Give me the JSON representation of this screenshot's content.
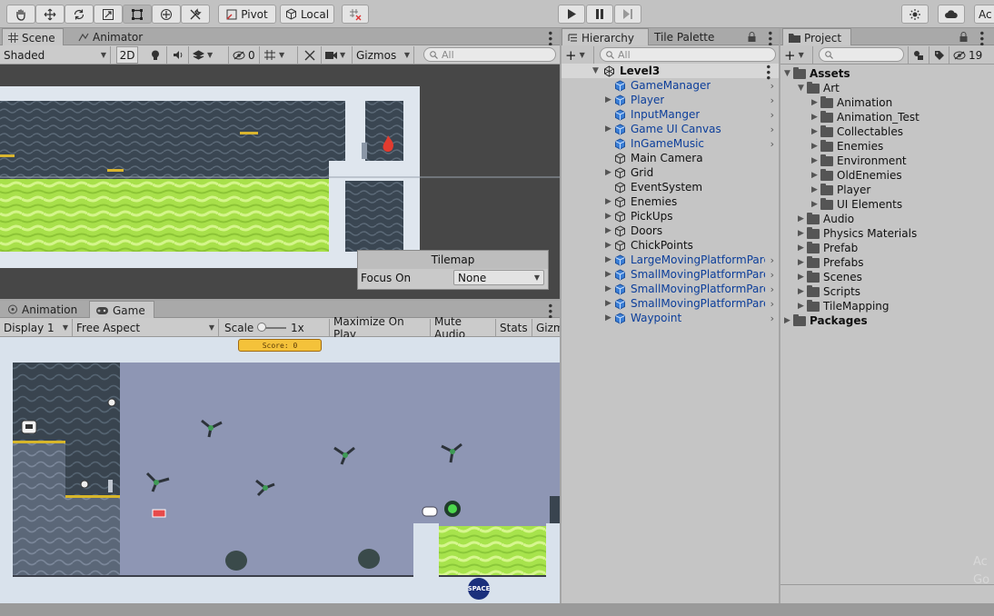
{
  "toolbar": {
    "pivot_label": "Pivot",
    "local_label": "Local",
    "account_label": "Ac"
  },
  "scene": {
    "tabs": [
      "Scene",
      "Animator"
    ],
    "shading_mode": "Shaded",
    "mode_2d": "2D",
    "hidden_count": "0",
    "gizmos_label": "Gizmos",
    "search_placeholder": "All",
    "tilemap_overlay": {
      "title": "Tilemap",
      "focus_label": "Focus On",
      "focus_value": "None"
    }
  },
  "game": {
    "tabs": [
      "Animation",
      "Game"
    ],
    "display": "Display 1",
    "aspect": "Free Aspect",
    "scale_label": "Scale",
    "scale_value": "1x",
    "maximize_label": "Maximize On Play",
    "mute_label": "Mute Audio",
    "stats_label": "Stats",
    "gizmos_label": "Gizm",
    "score_text": "Score: 0",
    "logo_text": "SPACE"
  },
  "hierarchy": {
    "tabs": [
      "Hierarchy",
      "Tile Palette"
    ],
    "search_placeholder": "All",
    "scene_name": "Level3",
    "items": [
      {
        "label": "GameManager",
        "prefab": true,
        "expandable": false
      },
      {
        "label": "Player",
        "prefab": true,
        "expandable": true
      },
      {
        "label": "InputManger",
        "prefab": true,
        "expandable": false
      },
      {
        "label": "Game UI Canvas",
        "prefab": true,
        "expandable": true
      },
      {
        "label": "InGameMusic",
        "prefab": true,
        "expandable": false
      },
      {
        "label": "Main Camera",
        "prefab": false,
        "expandable": false
      },
      {
        "label": "Grid",
        "prefab": false,
        "expandable": true
      },
      {
        "label": "EventSystem",
        "prefab": false,
        "expandable": false
      },
      {
        "label": "Enemies",
        "prefab": false,
        "expandable": true
      },
      {
        "label": "PickUps",
        "prefab": false,
        "expandable": true
      },
      {
        "label": "Doors",
        "prefab": false,
        "expandable": true
      },
      {
        "label": "ChickPoints",
        "prefab": false,
        "expandable": true
      },
      {
        "label": "LargeMovingPlatformPare",
        "prefab": true,
        "expandable": true
      },
      {
        "label": "SmallMovingPlatformPare",
        "prefab": true,
        "expandable": true
      },
      {
        "label": "SmallMovingPlatformPare",
        "prefab": true,
        "expandable": true
      },
      {
        "label": "SmallMovingPlatformPare",
        "prefab": true,
        "expandable": true
      },
      {
        "label": "Waypoint",
        "prefab": true,
        "expandable": true
      }
    ]
  },
  "project": {
    "tabs": [
      "Project"
    ],
    "hidden_count": "19",
    "tree": [
      {
        "label": "Assets",
        "depth": 0,
        "bold": true
      },
      {
        "label": "Art",
        "depth": 1,
        "bold": false
      },
      {
        "label": "Animation",
        "depth": 2,
        "bold": false
      },
      {
        "label": "Animation_Test",
        "depth": 2,
        "bold": false
      },
      {
        "label": "Collectables",
        "depth": 2,
        "bold": false
      },
      {
        "label": "Enemies",
        "depth": 2,
        "bold": false
      },
      {
        "label": "Environment",
        "depth": 2,
        "bold": false
      },
      {
        "label": "OldEnemies",
        "depth": 2,
        "bold": false
      },
      {
        "label": "Player",
        "depth": 2,
        "bold": false
      },
      {
        "label": "UI Elements",
        "depth": 2,
        "bold": false
      },
      {
        "label": "Audio",
        "depth": 1,
        "bold": false
      },
      {
        "label": "Physics Materials",
        "depth": 1,
        "bold": false
      },
      {
        "label": "Prefab",
        "depth": 1,
        "bold": false
      },
      {
        "label": "Prefabs",
        "depth": 1,
        "bold": false
      },
      {
        "label": "Scenes",
        "depth": 1,
        "bold": false
      },
      {
        "label": "Scripts",
        "depth": 1,
        "bold": false
      },
      {
        "label": "TileMapping",
        "depth": 1,
        "bold": false
      },
      {
        "label": "Packages",
        "depth": 0,
        "bold": true
      }
    ]
  },
  "watermark": "Ac\nGo",
  "colors": {
    "prefab_text": "#0c3e9a",
    "acid": "#a7e34c",
    "wall": "#39444f",
    "room_bg": "#8e96b4"
  }
}
